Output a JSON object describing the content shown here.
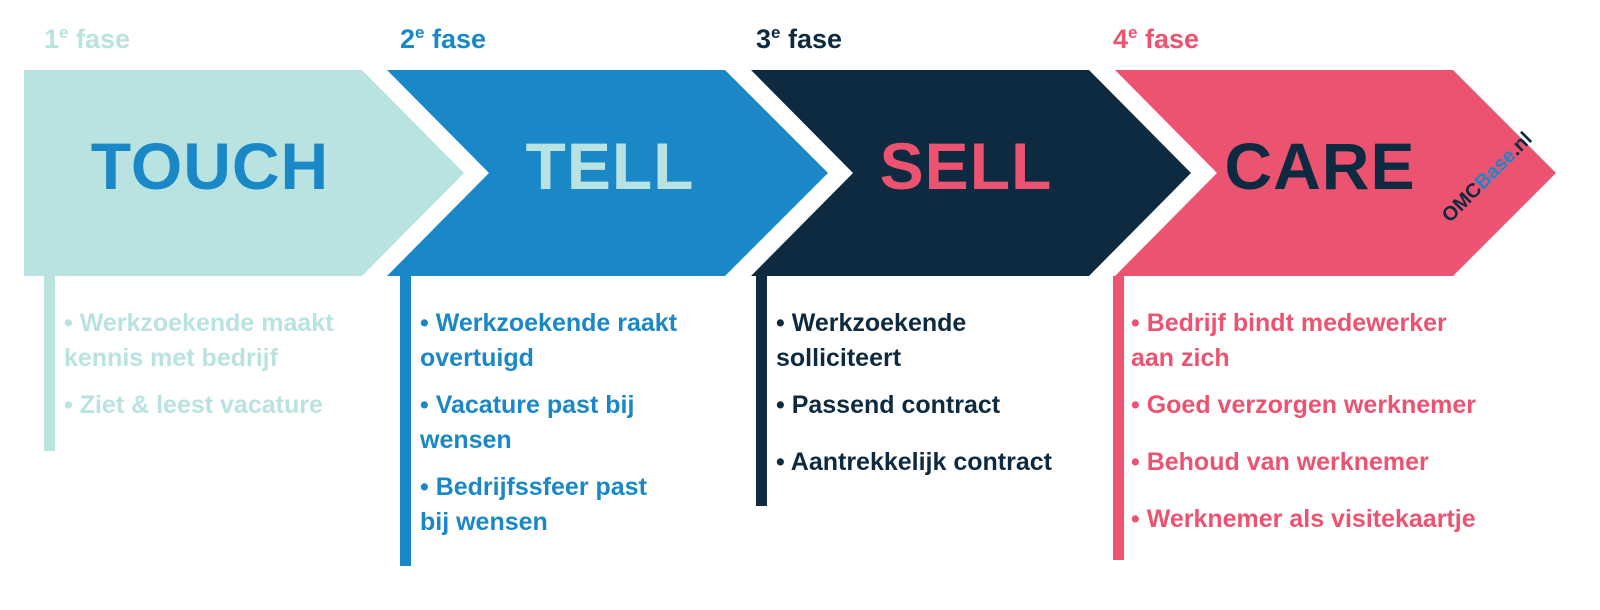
{
  "colors": {
    "teal": "#B8E3E1",
    "blue": "#1A87C7",
    "navy": "#0D2A40",
    "pink": "#EC5371"
  },
  "phases": [
    {
      "number": "1",
      "suffix": "e",
      "label": "fase",
      "title": "TOUCH",
      "color": "#B8E3E1",
      "title_color": "#1A87C7",
      "items": [
        "• Werkzoekende maakt kennis met bedrijf",
        "• Ziet & leest vacature"
      ]
    },
    {
      "number": "2",
      "suffix": "e",
      "label": "fase",
      "title": "TELL",
      "color": "#1A87C7",
      "title_color": "#B8E3E1",
      "items": [
        "• Werkzoekende raakt overtuigd",
        "• Vacature past bij wensen",
        "• Bedrijfssfeer past bij wensen"
      ]
    },
    {
      "number": "3",
      "suffix": "e",
      "label": "fase",
      "title": "SELL",
      "color": "#0D2A40",
      "title_color": "#EC5371",
      "items": [
        "• Werkzoekende solliciteert",
        "• Passend contract",
        "• Aantrekkelijk contract"
      ]
    },
    {
      "number": "4",
      "suffix": "e",
      "label": "fase",
      "title": "CARE",
      "color": "#EC5371",
      "title_color": "#0D2A40",
      "items": [
        "• Bedrijf bindt medewerker aan zich",
        "• Goed verzorgen werknemer",
        "• Behoud van werknemer",
        "• Werknemer als visitekaartje"
      ]
    }
  ],
  "logo": {
    "part1": "OMC",
    "part2": "Base",
    "part3": ".nl"
  }
}
